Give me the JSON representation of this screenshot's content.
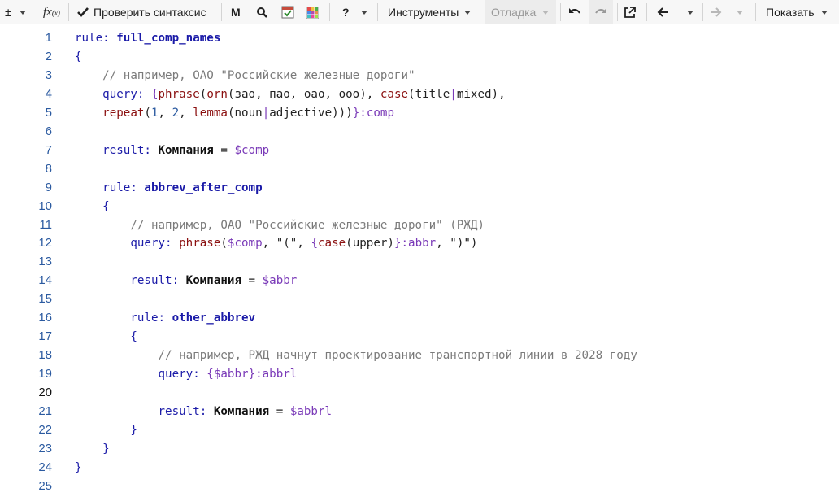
{
  "toolbar": {
    "plusminus": "±",
    "fx": "fx",
    "check_syntax": "Проверить синтаксис",
    "m_button": "M",
    "help": "?",
    "tools": "Инструменты",
    "debug": "Отладка",
    "show": "Показать"
  },
  "editor": {
    "lines": [
      [
        {
          "t": "rule: ",
          "c": "kw"
        },
        {
          "t": "full_comp_names",
          "c": "kwb"
        }
      ],
      [
        {
          "t": "{",
          "c": "kw"
        }
      ],
      [
        {
          "t": "    // например, ОАО \"Российские железные дороги\"",
          "c": "cm"
        }
      ],
      [
        {
          "t": "    query: ",
          "c": "kw"
        },
        {
          "t": "{",
          "c": "pu"
        },
        {
          "t": "phrase",
          "c": "fn"
        },
        {
          "t": "(",
          "c": "ar"
        },
        {
          "t": "orn",
          "c": "fn"
        },
        {
          "t": "(зао, пао, оао, ооо), ",
          "c": "ar"
        },
        {
          "t": "case",
          "c": "fn"
        },
        {
          "t": "(title",
          "c": "ar"
        },
        {
          "t": "|",
          "c": "pu"
        },
        {
          "t": "mixed),",
          "c": "ar"
        }
      ],
      [
        {
          "t": "    repeat",
          "c": "fn"
        },
        {
          "t": "(",
          "c": "ar"
        },
        {
          "t": "1",
          "c": "nu"
        },
        {
          "t": ", ",
          "c": "ar"
        },
        {
          "t": "2",
          "c": "nu"
        },
        {
          "t": ", ",
          "c": "ar"
        },
        {
          "t": "lemma",
          "c": "fn"
        },
        {
          "t": "(noun",
          "c": "ar"
        },
        {
          "t": "|",
          "c": "pu"
        },
        {
          "t": "adjective)))",
          "c": "ar"
        },
        {
          "t": "}:comp",
          "c": "pu"
        }
      ],
      [],
      [
        {
          "t": "    result: ",
          "c": "kw"
        },
        {
          "t": "Компания",
          "c": "bo"
        },
        {
          "t": " = ",
          "c": "ar"
        },
        {
          "t": "$comp",
          "c": "pu"
        }
      ],
      [],
      [
        {
          "t": "    rule: ",
          "c": "kw"
        },
        {
          "t": "abbrev_after_comp",
          "c": "kwb"
        }
      ],
      [
        {
          "t": "    {",
          "c": "kw"
        }
      ],
      [
        {
          "t": "        // например, ОАО \"Российские железные дороги\" (РЖД)",
          "c": "cm"
        }
      ],
      [
        {
          "t": "        query: ",
          "c": "kw"
        },
        {
          "t": "phrase",
          "c": "fn"
        },
        {
          "t": "(",
          "c": "ar"
        },
        {
          "t": "$comp",
          "c": "pu"
        },
        {
          "t": ", \"(\", ",
          "c": "ar"
        },
        {
          "t": "{",
          "c": "pu"
        },
        {
          "t": "case",
          "c": "fn"
        },
        {
          "t": "(upper)",
          "c": "ar"
        },
        {
          "t": "}:abbr",
          "c": "pu"
        },
        {
          "t": ", \")\")",
          "c": "ar"
        }
      ],
      [],
      [
        {
          "t": "        result: ",
          "c": "kw"
        },
        {
          "t": "Компания",
          "c": "bo"
        },
        {
          "t": " = ",
          "c": "ar"
        },
        {
          "t": "$abbr",
          "c": "pu"
        }
      ],
      [],
      [
        {
          "t": "        rule: ",
          "c": "kw"
        },
        {
          "t": "other_abbrev",
          "c": "kwb"
        }
      ],
      [
        {
          "t": "        {",
          "c": "kw"
        }
      ],
      [
        {
          "t": "            // например, РЖД начнут проектирование транспортной линии в 2028 году",
          "c": "cm"
        }
      ],
      [
        {
          "t": "            query: ",
          "c": "kw"
        },
        {
          "t": "{$abbr}:abbrl",
          "c": "pu"
        }
      ],
      [],
      [
        {
          "t": "            result: ",
          "c": "kw"
        },
        {
          "t": "Компания",
          "c": "bo"
        },
        {
          "t": " = ",
          "c": "ar"
        },
        {
          "t": "$abbrl",
          "c": "pu"
        }
      ],
      [
        {
          "t": "        }",
          "c": "kw"
        }
      ],
      [
        {
          "t": "    }",
          "c": "kw"
        }
      ],
      [
        {
          "t": "}",
          "c": "kw"
        }
      ],
      []
    ],
    "line_numbers": [
      "1",
      "2",
      "3",
      "4",
      "5",
      "6",
      "7",
      "8",
      "9",
      "10",
      "11",
      "12",
      "13",
      "14",
      "15",
      "16",
      "17",
      "18",
      "19",
      "20",
      "21",
      "22",
      "23",
      "24",
      "25"
    ],
    "current_line": "20"
  }
}
